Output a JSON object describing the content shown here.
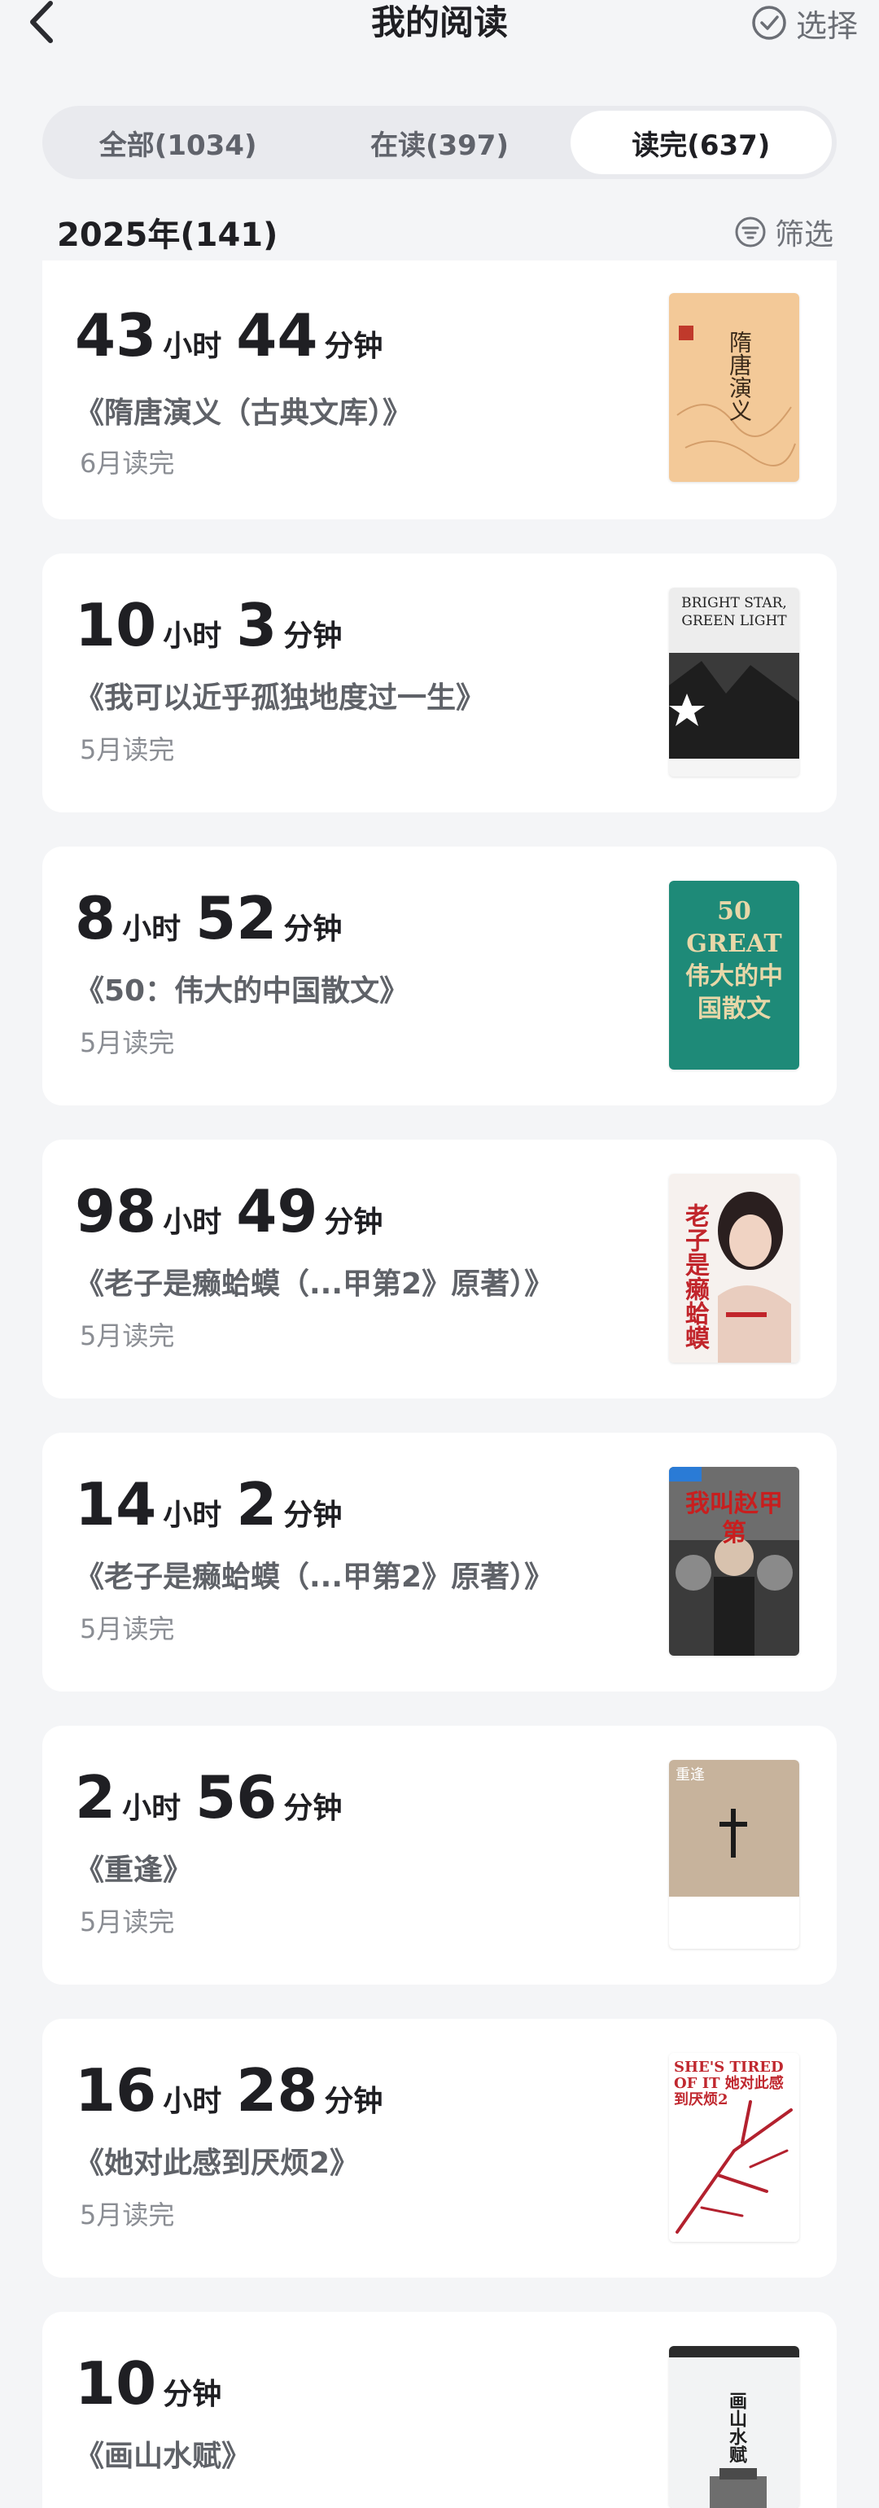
{
  "header": {
    "title": "我的阅读",
    "select_label": "选择"
  },
  "tabs": [
    {
      "label": "全部(1034)",
      "active": false
    },
    {
      "label": "在读(397)",
      "active": false
    },
    {
      "label": "读完(637)",
      "active": true
    }
  ],
  "year": {
    "label": "2025年(141)",
    "filter_label": "筛选"
  },
  "units": {
    "hour": "小时",
    "minute": "分钟"
  },
  "books": [
    {
      "hours": "43",
      "minutes": "44",
      "title": "《隋唐演义（古典文库）》",
      "status": "6月读完",
      "cover_text": "隋唐演义"
    },
    {
      "hours": "10",
      "minutes": "3",
      "title": "《我可以近乎孤独地度过一生》",
      "status": "5月读完",
      "cover_text": "BRIGHT STAR, GREEN LIGHT"
    },
    {
      "hours": "8",
      "minutes": "52",
      "title": "《50：伟大的中国散文》",
      "status": "5月读完",
      "cover_text": "50 GREAT 伟大的中国散文"
    },
    {
      "hours": "98",
      "minutes": "49",
      "title": "《老子是癞蛤蟆（...甲第2》原著）》",
      "status": "5月读完",
      "cover_text": "老子是癞蛤蟆"
    },
    {
      "hours": "14",
      "minutes": "2",
      "title": "《老子是癞蛤蟆（...甲第2》原著）》",
      "status": "5月读完",
      "cover_text": "我叫赵甲第"
    },
    {
      "hours": "2",
      "minutes": "56",
      "title": "《重逢》",
      "status": "5月读完",
      "cover_text": "重逢"
    },
    {
      "hours": "16",
      "minutes": "28",
      "title": "《她对此感到厌烦2》",
      "status": "5月读完",
      "cover_text": "SHE'S TIRED OF IT 她对此感到厌烦2"
    },
    {
      "hours": "",
      "minutes": "10",
      "title": "《画山水赋》",
      "status": "",
      "cover_text": "画山水赋"
    }
  ],
  "colors": {
    "background": "#F4F5F7",
    "card": "#FFFFFF",
    "text_primary": "#1F1F23",
    "text_secondary": "#5F6268",
    "text_muted": "#8A8D93"
  }
}
